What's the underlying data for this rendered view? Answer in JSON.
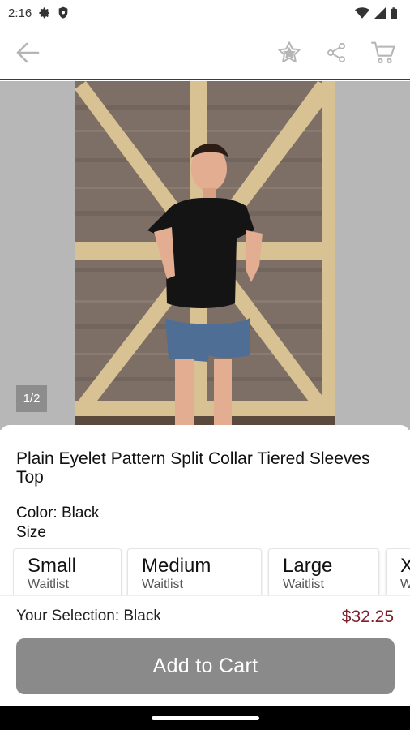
{
  "status_bar": {
    "time": "2:16",
    "icons": [
      "settings-gear-icon",
      "shield-icon",
      "wifi-icon",
      "signal-icon",
      "battery-icon"
    ]
  },
  "toolbar": {
    "back_icon": "arrow-left-icon",
    "actions": [
      "star-icon",
      "share-icon",
      "cart-icon"
    ],
    "accent_color": "#7a1f2b"
  },
  "gallery": {
    "counter": "1/2"
  },
  "product": {
    "title": "Plain Eyelet Pattern Split Collar Tiered Sleeves Top",
    "color_line": "Color: Black",
    "size_label": "Size",
    "sizes": [
      {
        "name": "Small",
        "status": "Waitlist"
      },
      {
        "name": "Medium",
        "status": "Waitlist"
      },
      {
        "name": "Large",
        "status": "Waitlist"
      },
      {
        "name": "X",
        "status": "W"
      }
    ]
  },
  "purchase": {
    "selection": "Your Selection: Black",
    "price": "$32.25",
    "add_to_cart": "Add to Cart",
    "button_color": "#8a8a8a"
  }
}
